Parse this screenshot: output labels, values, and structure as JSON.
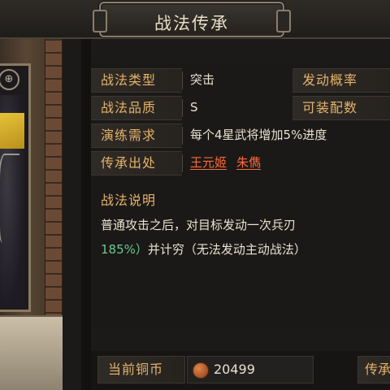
{
  "header": {
    "title": "战法传承"
  },
  "card": {
    "badge": "⊕"
  },
  "info": {
    "type_label": "战法类型",
    "type_value": "突击",
    "prob_label": "发动概率",
    "quality_label": "战法品质",
    "quality_value": "S",
    "equip_label": "可装配数",
    "train_label": "演练需求",
    "train_value": "每个4星武将增加5%进度",
    "source_label": "传承出处",
    "sources": [
      "王元姬",
      "朱儁"
    ]
  },
  "description": {
    "title": "战法说明",
    "line1": "普通攻击之后，对目标发动一次兵刃",
    "line2_highlight": "185%）",
    "line2_rest": "并计穷（无法发动主动战法）"
  },
  "bottom": {
    "coin_label": "当前铜币",
    "coin_value": "20499",
    "inherit_label": "传承"
  }
}
